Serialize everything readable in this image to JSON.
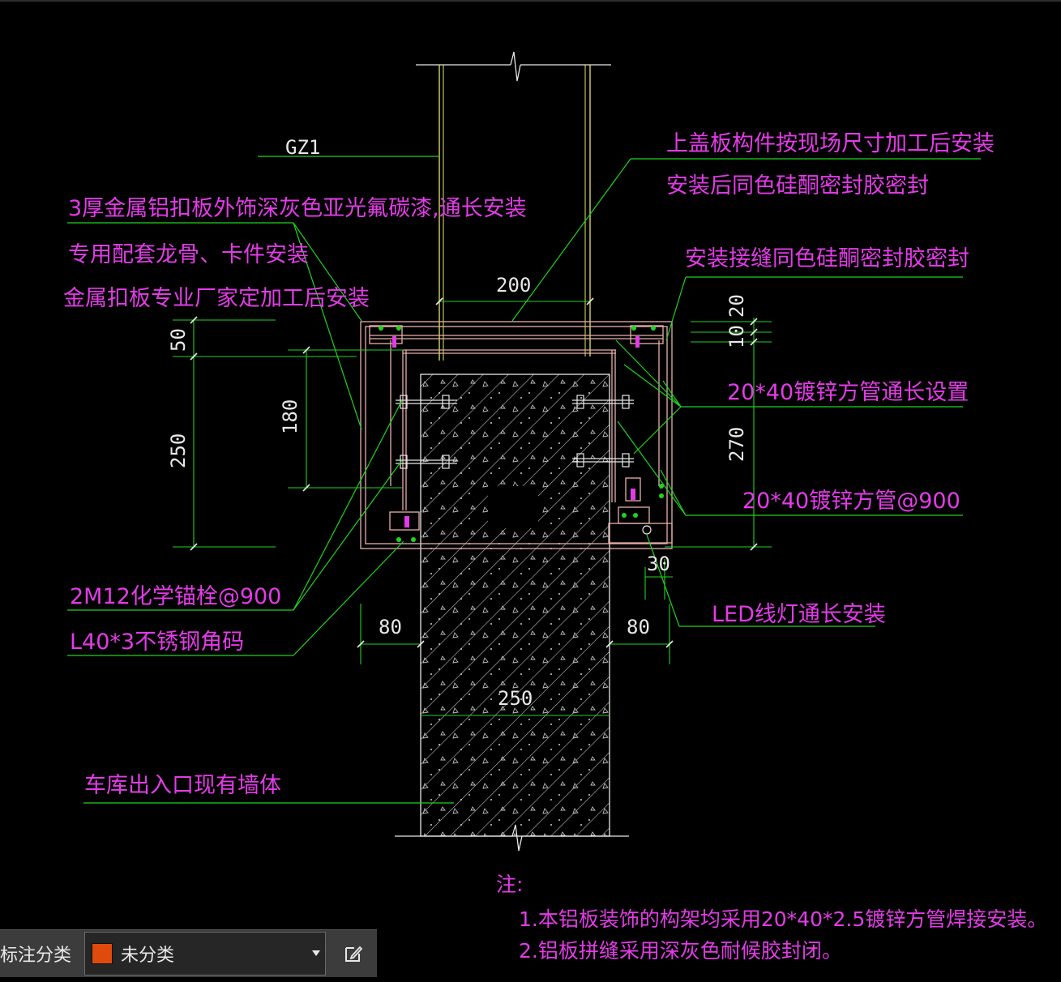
{
  "drawing": {
    "column_label": "GZ1",
    "annotations": {
      "cap_plate_1": "上盖板构件按现场尺寸加工后安装",
      "cap_plate_2": "安装后同色硅酮密封胶密封",
      "panel_1": "3厚金属铝扣板外饰深灰色亚光氟碳漆,通长安装",
      "panel_2": "专用配套龙骨、卡件安装",
      "panel_3": "金属扣板专业厂家定加工后安装",
      "joint_seal": "安装接缝同色硅酮密封胶密封",
      "tube_long": "20*40镀锌方管通长设置",
      "tube_900": "20*40镀锌方管@900",
      "anchor": "2M12化学锚栓@900",
      "angle": "L40*3不锈钢角码",
      "led": "LED线灯通长安装",
      "wall": "车库出入口现有墙体"
    },
    "dimensions": {
      "top_width": "200",
      "left_50": "50",
      "left_250": "250",
      "left_180": "180",
      "right_20": "20",
      "right_10": "10",
      "right_270": "270",
      "led_30": "30",
      "bottom_80_left": "80",
      "bottom_80_right": "80",
      "wall_250": "250"
    },
    "notes": {
      "title": "注:",
      "line1": "1.本铝板装饰的构架均采用20*40*2.5镀锌方管焊接安装。",
      "line2": "2.铝板拼缝采用深灰色耐候胶封闭。"
    },
    "colors": {
      "leader": "#1fd41f",
      "text": "#e23ce6",
      "dim": "#e8e8e8",
      "frame": "#e8b0a8",
      "column": "#e6e66a",
      "hatch": "#cfcfcf"
    }
  },
  "toolbar": {
    "label": "标注分类",
    "selected": "未分类",
    "swatch_color": "#e04a0c",
    "edit_icon": "edit-icon"
  }
}
